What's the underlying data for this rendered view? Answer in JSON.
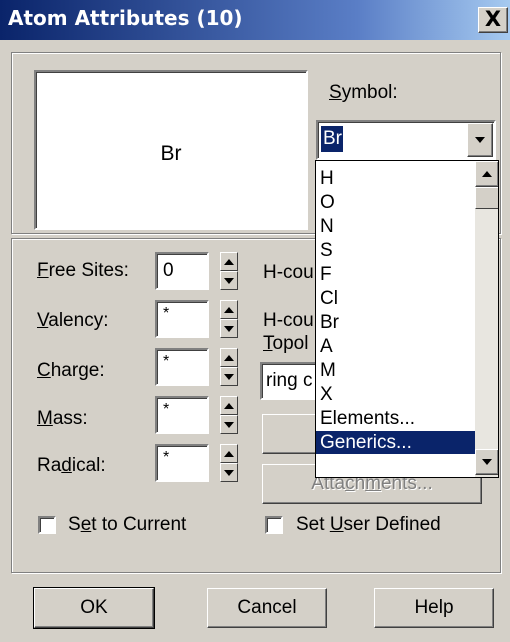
{
  "window": {
    "title": "Atom Attributes (10)",
    "close_glyph": "X"
  },
  "preview": {
    "atom_label": "Br"
  },
  "symbol": {
    "label_u": "S",
    "label_rest": "ymbol:",
    "value": "Br",
    "options": [
      "H",
      "O",
      "N",
      "S",
      "F",
      "Cl",
      "Br",
      "A",
      "M",
      "X",
      "Elements...",
      "Generics..."
    ],
    "highlighted_option": "Generics..."
  },
  "fields": {
    "free_sites": {
      "label_u": "F",
      "label_rest": "ree Sites:",
      "value": "0"
    },
    "valency": {
      "label_u": "V",
      "label_rest": "alency:",
      "value": "*"
    },
    "charge": {
      "label_u": "C",
      "label_rest": "harge:",
      "value": "*"
    },
    "mass": {
      "label_u": "M",
      "label_rest": "ass:",
      "value": "*"
    },
    "radical": {
      "label_pre": "Ra",
      "label_u": "d",
      "label_rest": "ical:",
      "value": "*"
    }
  },
  "right_column": {
    "hcount_1": "H-cou",
    "hcount_2": "H-cou",
    "topol_u": "T",
    "topol_rest": "opol",
    "topol_value": "ring c",
    "attachments_pre": "Atta",
    "attachments_u": "c",
    "attachments_mid": "h",
    "attachments_u2": "m",
    "attachments_rest": "ents..."
  },
  "checkboxes": {
    "set_to_current": {
      "pre": "S",
      "u": "e",
      "rest": "t to Current",
      "checked": false
    },
    "set_user_defined": {
      "pre": "Set ",
      "u": "U",
      "rest": "ser Defined",
      "checked": false
    }
  },
  "buttons": {
    "ok": "OK",
    "cancel": "Cancel",
    "help": "Help"
  },
  "colors": {
    "face": "#d4d0c8",
    "title_start": "#0a246a",
    "selection": "#0a246a"
  }
}
